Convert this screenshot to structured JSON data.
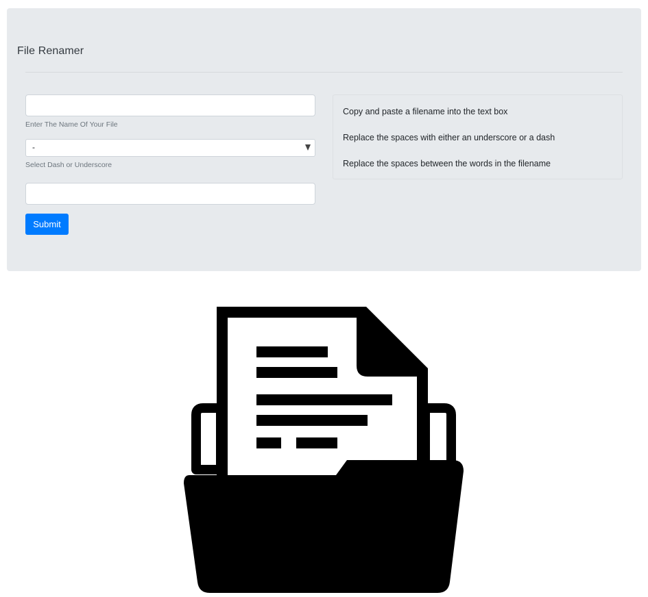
{
  "app": {
    "title": "File Renamer"
  },
  "form": {
    "filename_input": {
      "value": "",
      "help": "Enter The Name Of Your File"
    },
    "separator_select": {
      "selected": "-",
      "help": "Select Dash or Underscore"
    },
    "result_input": {
      "value": ""
    },
    "submit_label": "Submit"
  },
  "instructions": [
    "Copy and paste a filename into the text box",
    "Replace the spaces with either an underscore or a dash",
    "Replace the spaces between the words in the filename"
  ],
  "illustration": {
    "icon": "folder-with-document-icon"
  },
  "colors": {
    "panel_background": "#e7eaed",
    "primary_button": "#007bff",
    "icon": "#000000"
  }
}
